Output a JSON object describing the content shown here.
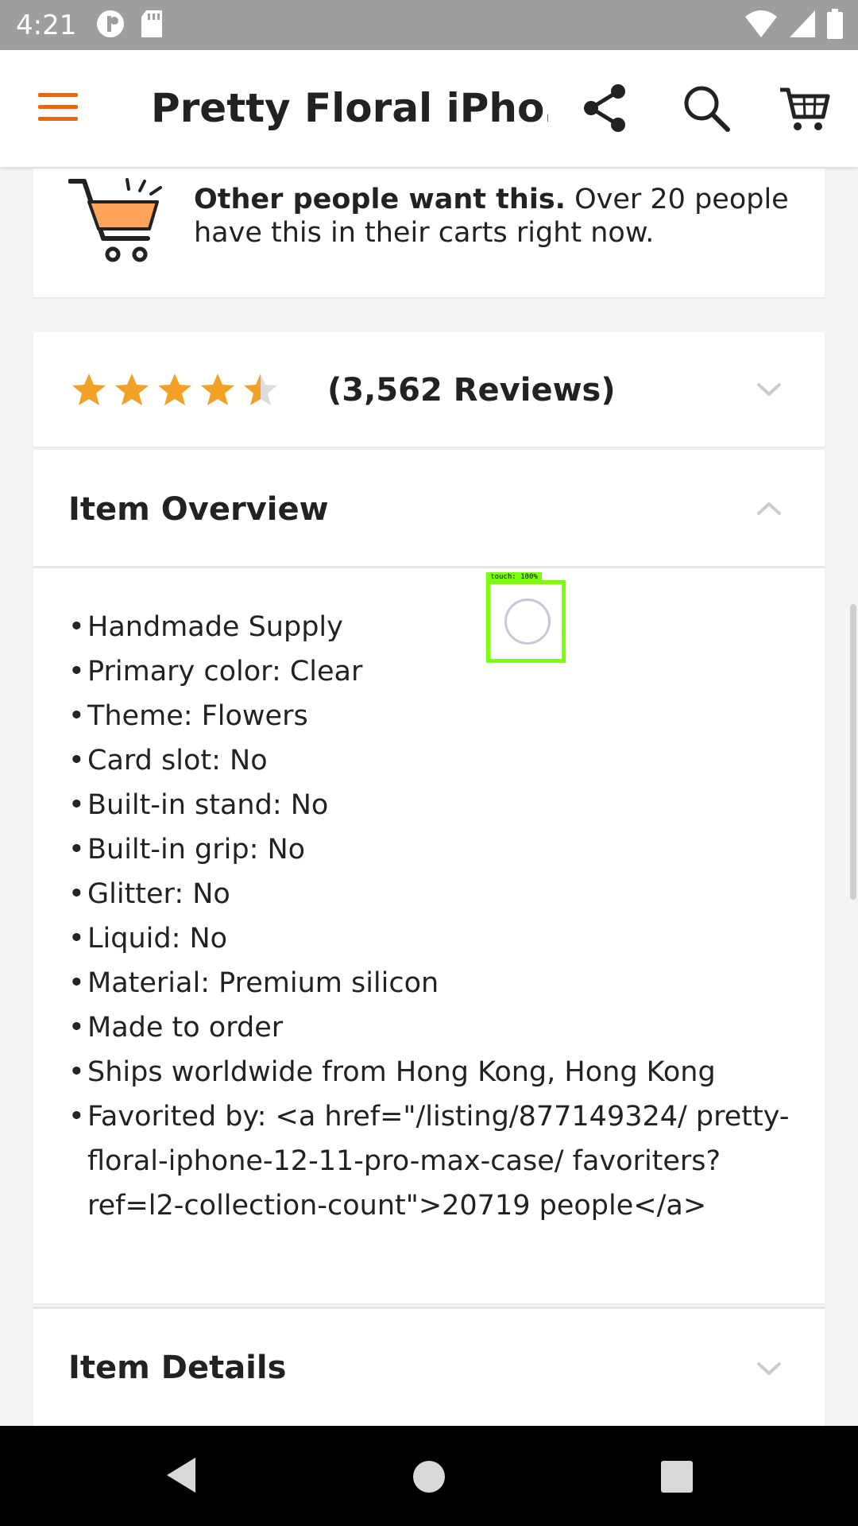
{
  "status_bar": {
    "time": "4:21",
    "icons": [
      "notification-icon",
      "sd-card-icon",
      "wifi-icon",
      "signal-icon",
      "battery-icon"
    ]
  },
  "app_bar": {
    "title": "Pretty Floral iPho…",
    "icons": [
      "menu-icon",
      "share-icon",
      "search-icon",
      "cart-icon"
    ],
    "accent_color": "#e8660f"
  },
  "cart_notice": {
    "bold": "Other people want this.",
    "text": " Over 20 people have this in their carts right now."
  },
  "reviews": {
    "rating": 4.5,
    "max_rating": 5,
    "count_label": "(3,562 Reviews)",
    "star_color": "#f1a125"
  },
  "item_overview": {
    "title": "Item Overview",
    "items": [
      "Handmade Supply",
      "Primary color: Clear",
      "Theme: Flowers",
      "Card slot: No",
      "Built-in stand: No",
      "Built-in grip: No",
      "Glitter: No",
      "Liquid: No",
      "Material: Premium silicon",
      "Made to order",
      "Ships worldwide from Hong Kong, Hong Kong",
      "Favorited by: <a href=\"/listing/877149324/ pretty-floral-iphone-12-11-pro-max-case/ favoriters?ref=l2-collection-count\">20719 people</a>"
    ]
  },
  "item_details": {
    "title": "Item Details"
  },
  "touch_overlay": {
    "label": "touch: 100%"
  }
}
